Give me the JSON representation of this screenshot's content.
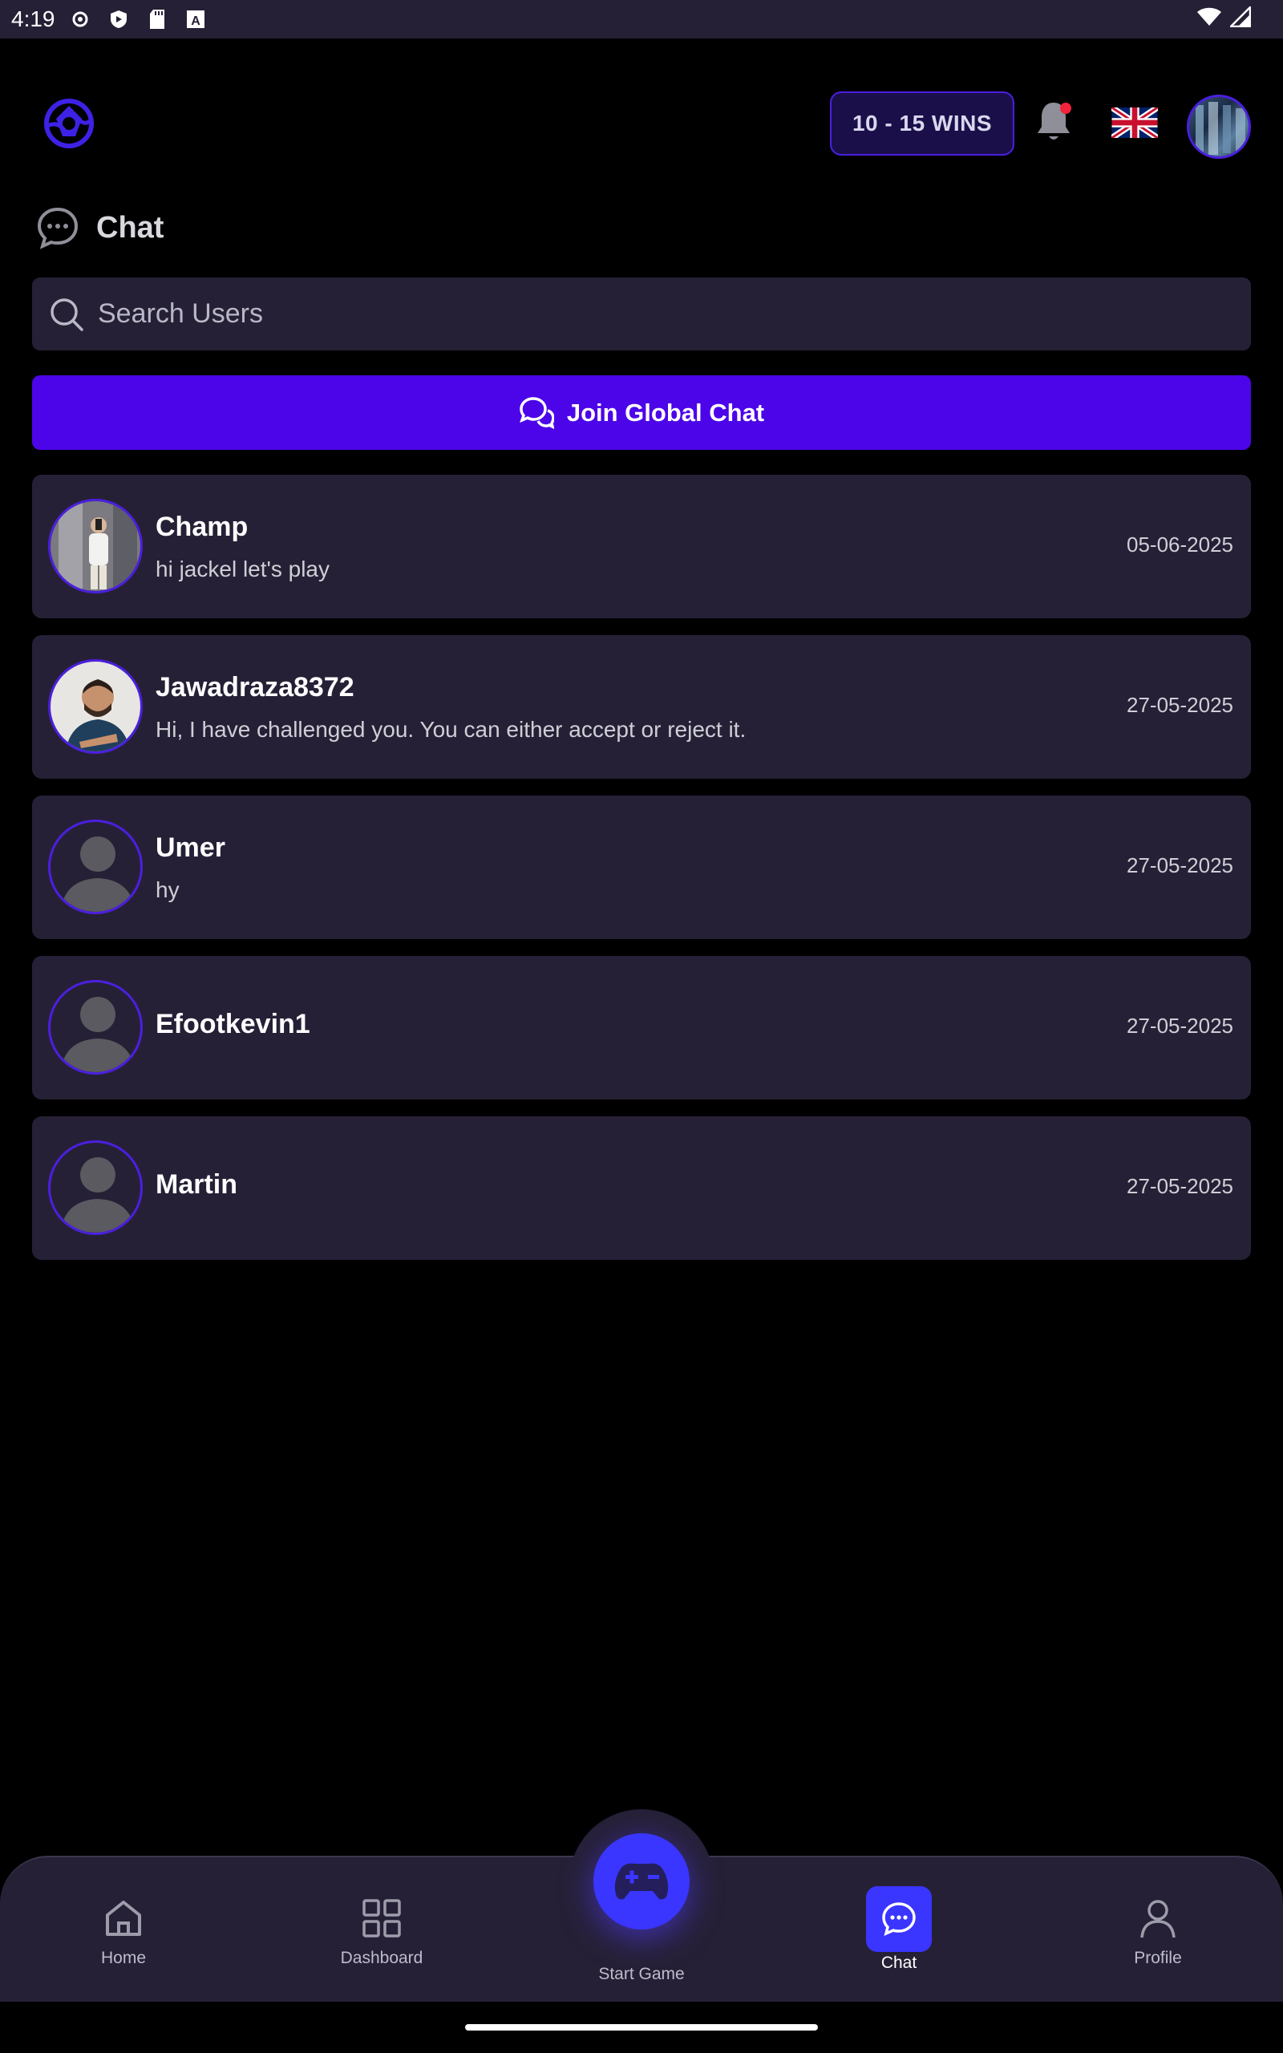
{
  "status_bar": {
    "time": "4:19"
  },
  "header": {
    "wins_label": "10 - 15 WINS"
  },
  "page": {
    "title": "Chat"
  },
  "search": {
    "placeholder": "Search Users"
  },
  "join_global_chat": {
    "label": "Join Global Chat"
  },
  "chats": [
    {
      "name": "Champ",
      "message": "hi jackel let's play",
      "date": "05-06-2025",
      "avatar": "photo"
    },
    {
      "name": "Jawadraza8372",
      "message": "Hi, I have challenged you. You can either accept or reject it.",
      "date": "27-05-2025",
      "avatar": "photo"
    },
    {
      "name": "Umer",
      "message": "hy",
      "date": "27-05-2025",
      "avatar": "placeholder"
    },
    {
      "name": "Efootkevin1",
      "message": "",
      "date": "27-05-2025",
      "avatar": "placeholder"
    },
    {
      "name": "Martin",
      "message": "",
      "date": "27-05-2025",
      "avatar": "placeholder"
    }
  ],
  "bottom_nav": {
    "home": "Home",
    "dashboard": "Dashboard",
    "start_game": "Start Game",
    "chat": "Chat",
    "profile": "Profile",
    "active": "chat"
  },
  "colors": {
    "accent": "#4c05e8",
    "nav_active": "#3a35ff",
    "card_bg": "#262036",
    "notification_dot": "#f0243c"
  }
}
